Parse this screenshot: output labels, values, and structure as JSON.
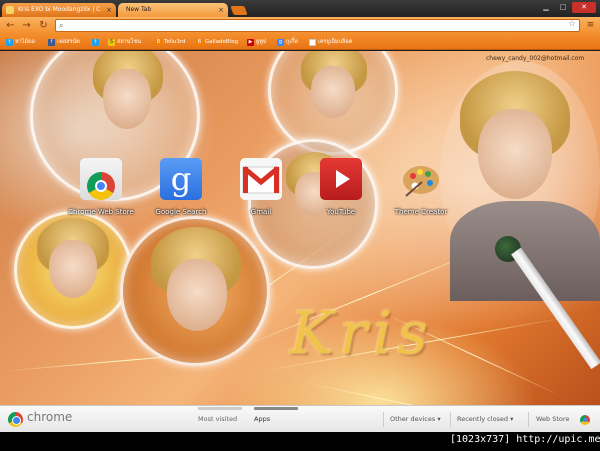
{
  "tabs": [
    {
      "title": "Kris EXO bi Moodangzilx | C",
      "active": false
    },
    {
      "title": "New Tab",
      "active": true
    }
  ],
  "omnibox": {
    "value": "",
    "placeholder": ""
  },
  "bookmarks": [
    {
      "label": "หาไม้ดอ",
      "icon": "twitter-icon",
      "color": "#1da1f2"
    },
    {
      "label": "เฟสสรน์ต",
      "icon": "facebook-icon",
      "color": "#3b5998"
    },
    {
      "label": "",
      "icon": "twitter-icon",
      "color": "#1da1f2"
    },
    {
      "label": "สถานโชน",
      "icon": "bookmark-icon",
      "color": "#f1c40f"
    },
    {
      "label": "Tellu3rd",
      "icon": "blogger-icon",
      "color": "#f57d00"
    },
    {
      "label": "GalladeBlog",
      "icon": "blogger-icon",
      "color": "#f57d00"
    },
    {
      "label": "ยูทูป",
      "icon": "youtube-icon",
      "color": "#cc0000"
    },
    {
      "label": "กูเกิ้ล",
      "icon": "google-icon",
      "color": "#4285f4"
    },
    {
      "label": "เครยูเอ็มบล็อค",
      "icon": "page-icon",
      "color": "#ffffff"
    }
  ],
  "theme": {
    "email": "chewy_candy_002@hotmail.com",
    "signature": "Kris"
  },
  "apps": [
    {
      "label": "Chrome Web Store"
    },
    {
      "label": "Google Search"
    },
    {
      "label": "Gmail"
    },
    {
      "label": "YouTube"
    },
    {
      "label": "Theme Creator"
    }
  ],
  "footer": {
    "brand": "chrome",
    "most_visited": "Most visited",
    "apps": "Apps",
    "other_devices": "Other devices",
    "recently_closed": "Recently closed",
    "web_store": "Web Store"
  },
  "caption": "[1023x737] http://upic.me/"
}
